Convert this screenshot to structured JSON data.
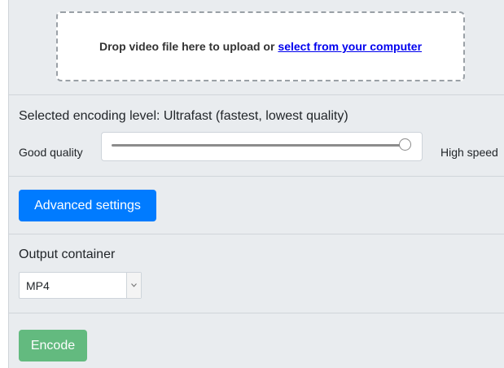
{
  "upload": {
    "drop_text": "Drop video file here to upload or",
    "select_link": "select from your computer"
  },
  "encoding": {
    "level_text": "Selected encoding level: Ultrafast (fastest, lowest quality)",
    "left_label": "Good quality",
    "right_label": "High speed",
    "slider_value": 1.0
  },
  "advanced": {
    "button_label": "Advanced settings"
  },
  "output": {
    "label": "Output container",
    "selected": "MP4"
  },
  "encode": {
    "button_label": "Encode"
  },
  "colors": {
    "primary": "#007bff",
    "success_disabled": "#5cb87a",
    "panel_bg": "#e9ecef"
  }
}
